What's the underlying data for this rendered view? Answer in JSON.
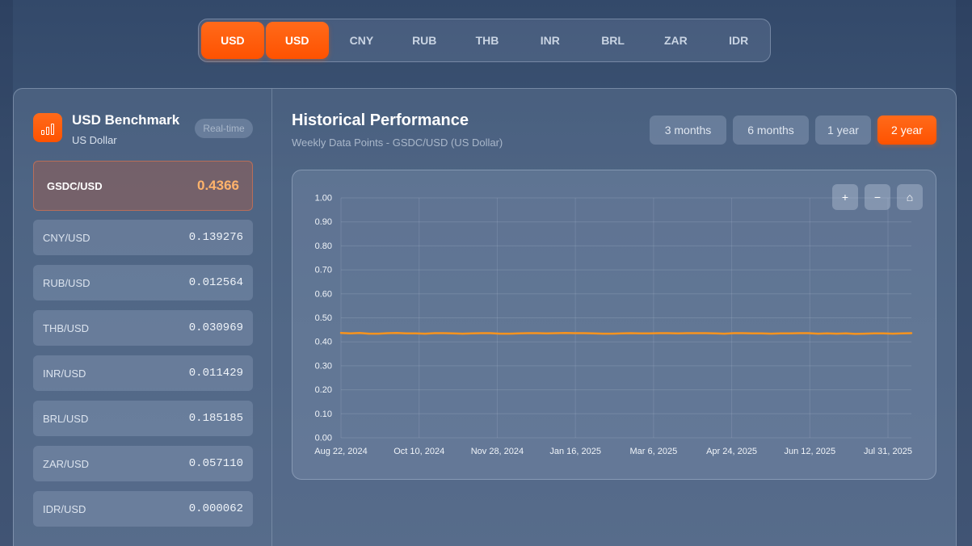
{
  "currency_tabs": [
    {
      "label": "USD",
      "active": true
    },
    {
      "label": "USD",
      "active": true
    },
    {
      "label": "CNY",
      "active": false
    },
    {
      "label": "RUB",
      "active": false
    },
    {
      "label": "THB",
      "active": false
    },
    {
      "label": "INR",
      "active": false
    },
    {
      "label": "BRL",
      "active": false
    },
    {
      "label": "ZAR",
      "active": false
    },
    {
      "label": "IDR",
      "active": false
    }
  ],
  "benchmark": {
    "title": "USD Benchmark",
    "subtitle": "US Dollar",
    "badge": "Real-time",
    "icon": "bar-chart-icon",
    "accent": "#ff5a00"
  },
  "primary_rate": {
    "pair": "GSDC/USD",
    "value": "0.4366"
  },
  "rates": [
    {
      "pair": "CNY/USD",
      "value": "0.139276"
    },
    {
      "pair": "RUB/USD",
      "value": "0.012564"
    },
    {
      "pair": "THB/USD",
      "value": "0.030969"
    },
    {
      "pair": "INR/USD",
      "value": "0.011429"
    },
    {
      "pair": "BRL/USD",
      "value": "0.185185"
    },
    {
      "pair": "ZAR/USD",
      "value": "0.057110"
    },
    {
      "pair": "IDR/USD",
      "value": "0.000062"
    }
  ],
  "history": {
    "title": "Historical Performance",
    "subtitle": "Weekly Data Points - GSDC/USD (US Dollar)",
    "periods": [
      {
        "label": "3 months",
        "active": false
      },
      {
        "label": "6 months",
        "active": false
      },
      {
        "label": "1 year",
        "active": false
      },
      {
        "label": "2 year",
        "active": true
      }
    ],
    "zoom": {
      "in": "+",
      "out": "−",
      "home": "⌂"
    }
  },
  "chart_data": {
    "type": "line",
    "title": "",
    "xlabel": "",
    "ylabel": "",
    "x_ticks": [
      "Aug 22, 2024",
      "Oct 10, 2024",
      "Nov 28, 2024",
      "Jan 16, 2025",
      "Mar 6, 2025",
      "Apr 24, 2025",
      "Jun 12, 2025",
      "Jul 31, 2025"
    ],
    "y_ticks": [
      "0.00",
      "0.10",
      "0.20",
      "0.30",
      "0.40",
      "0.50",
      "0.60",
      "0.70",
      "0.80",
      "0.90",
      "1.00"
    ],
    "ylim": [
      0,
      1
    ],
    "grid": true,
    "line_color": "#f7931e",
    "series": [
      {
        "values": [
          0.437,
          0.435,
          0.437,
          0.434,
          0.434,
          0.436,
          0.437,
          0.435,
          0.435,
          0.434,
          0.436,
          0.436,
          0.435,
          0.434,
          0.435,
          0.436,
          0.436,
          0.434,
          0.434,
          0.435,
          0.436,
          0.436,
          0.435,
          0.436,
          0.437,
          0.436,
          0.436,
          0.435,
          0.434,
          0.434,
          0.435,
          0.436,
          0.435,
          0.435,
          0.436,
          0.436,
          0.435,
          0.436,
          0.436,
          0.436,
          0.435,
          0.434,
          0.436,
          0.436,
          0.435,
          0.435,
          0.434,
          0.435,
          0.435,
          0.436,
          0.436,
          0.434,
          0.435,
          0.434,
          0.435,
          0.433,
          0.434,
          0.435,
          0.435,
          0.434,
          0.435,
          0.436
        ]
      }
    ]
  }
}
